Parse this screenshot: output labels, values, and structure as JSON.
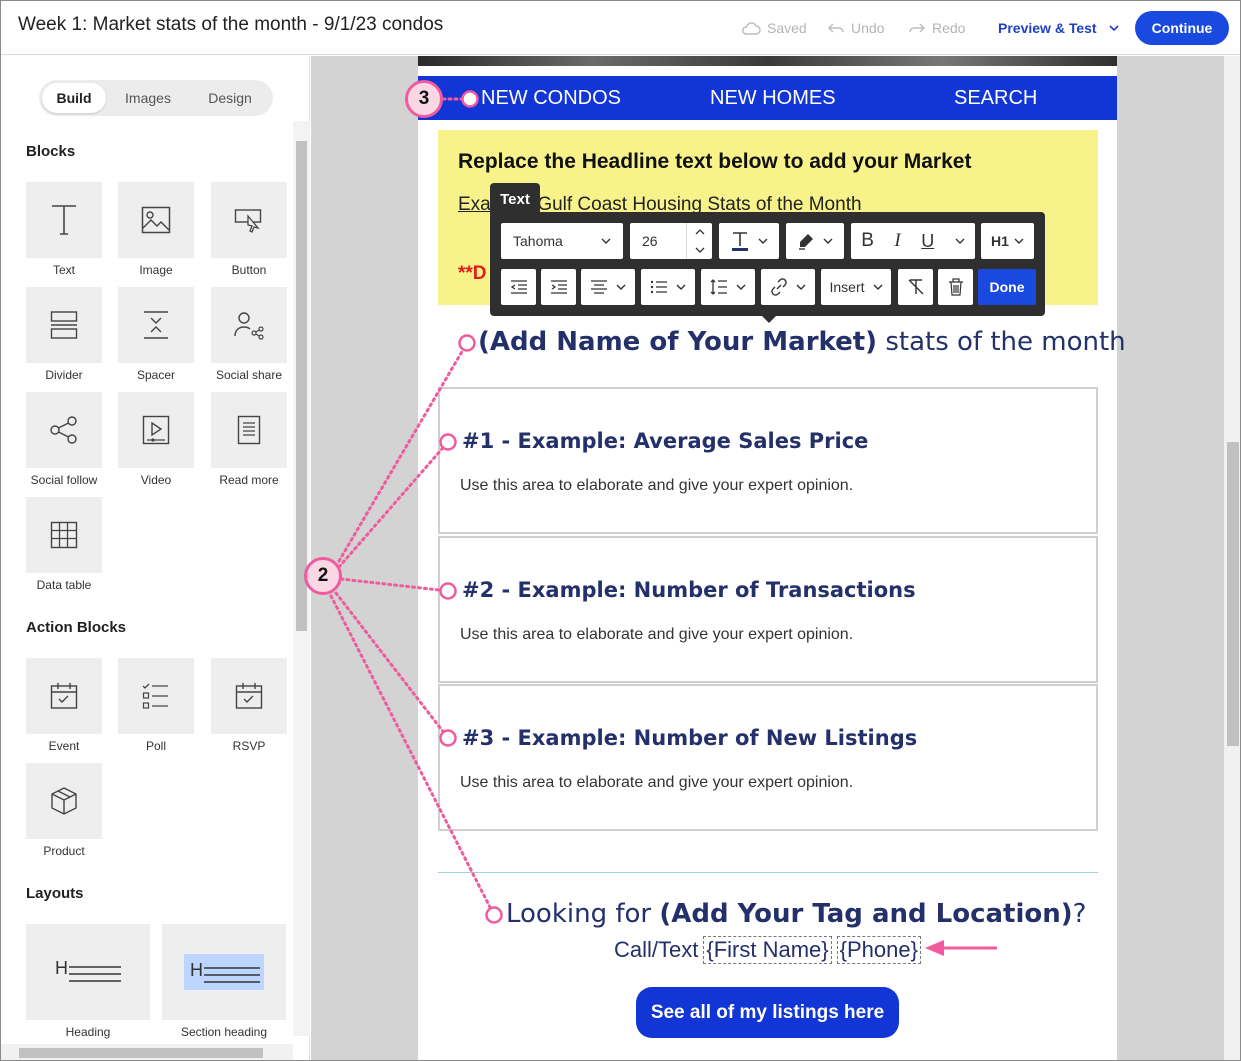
{
  "header": {
    "title": "Week 1: Market stats of the month - 9/1/23 condos",
    "saved_label": "Saved",
    "undo_label": "Undo",
    "redo_label": "Redo",
    "preview_label": "Preview & Test",
    "continue_label": "Continue"
  },
  "sidebar": {
    "tabs": [
      {
        "label": "Build",
        "active": true
      },
      {
        "label": "Images",
        "active": false
      },
      {
        "label": "Design",
        "active": false
      }
    ],
    "blocks_heading": "Blocks",
    "blocks": [
      {
        "label": "Text",
        "icon": "text-icon"
      },
      {
        "label": "Image",
        "icon": "image-icon"
      },
      {
        "label": "Button",
        "icon": "button-icon"
      },
      {
        "label": "Divider",
        "icon": "divider-icon"
      },
      {
        "label": "Spacer",
        "icon": "spacer-icon"
      },
      {
        "label": "Social share",
        "icon": "social-share-icon"
      },
      {
        "label": "Social follow",
        "icon": "social-follow-icon"
      },
      {
        "label": "Video",
        "icon": "video-icon"
      },
      {
        "label": "Read more",
        "icon": "read-more-icon"
      },
      {
        "label": "Data table",
        "icon": "data-table-icon"
      }
    ],
    "action_blocks_heading": "Action Blocks",
    "action_blocks": [
      {
        "label": "Event",
        "icon": "calendar-icon"
      },
      {
        "label": "Poll",
        "icon": "poll-icon"
      },
      {
        "label": "RSVP",
        "icon": "rsvp-icon"
      },
      {
        "label": "Product",
        "icon": "product-box-icon"
      }
    ],
    "layouts_heading": "Layouts",
    "layouts": [
      {
        "label": "Heading",
        "icon": "heading-layout-icon"
      },
      {
        "label": "Section heading",
        "icon": "section-heading-layout-icon"
      }
    ]
  },
  "email": {
    "nav": [
      "NEW CONDOS",
      "NEW HOMES",
      "SEARCH"
    ],
    "notice_headline": "Replace the Headline text below to add your Market",
    "notice_example_prefix": "Exa",
    "notice_example_rest": "Gulf Coast Housing Stats of the Month",
    "notice_red": "**D",
    "market_bold": "(Add Name of Your Market)",
    "market_rest": " stats of the month",
    "stats": [
      {
        "title": "#1 - Example: Average Sales Price",
        "body": "Use this area to elaborate and give your expert opinion."
      },
      {
        "title": "#2 - Example: Number of Transactions",
        "body": "Use this area to elaborate and give your expert opinion."
      },
      {
        "title": "#3 - Example: Number of New Listings",
        "body": "Use this area to elaborate and give your expert opinion."
      }
    ],
    "looking_prefix": "Looking for ",
    "looking_bold": "(Add Your Tag and Location)",
    "looking_suffix": "?",
    "call_label": "Call/Text",
    "merge_first_name": "{First Name}",
    "merge_phone": "{Phone}",
    "listings_button": "See all of my listings here"
  },
  "text_toolbar": {
    "tag": "Text",
    "font_family": "Tahoma",
    "font_size": "26",
    "heading_level": "H1",
    "insert_label": "Insert",
    "done_label": "Done"
  },
  "annotations": {
    "badge_2": "2",
    "badge_3": "3"
  },
  "colors": {
    "brand_blue": "#1a49e0",
    "nav_blue": "#1235d6",
    "notice_yellow": "#f7f28a",
    "annotation_pink": "#ef5b9c",
    "text_navy": "#24306a"
  }
}
